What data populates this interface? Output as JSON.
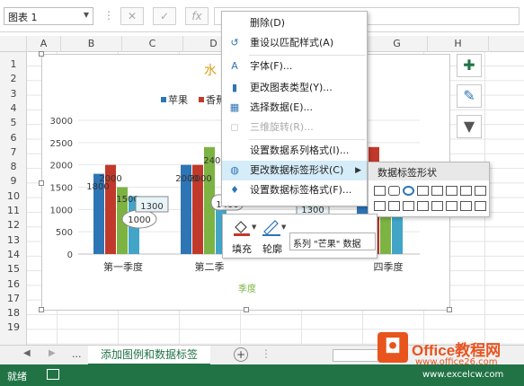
{
  "formula_bar": {
    "name_box": "图表 1",
    "cancel": "✕",
    "enter": "✓",
    "fx": "fx"
  },
  "columns": [
    "A",
    "B",
    "C",
    "D",
    "E",
    "F",
    "G",
    "H"
  ],
  "rows": [
    "1",
    "2",
    "3",
    "4",
    "5",
    "6",
    "7",
    "8",
    "9",
    "10",
    "11",
    "12",
    "13",
    "14",
    "15",
    "16",
    "17",
    "18",
    "19"
  ],
  "chart": {
    "title_fragment": "水",
    "legend": [
      {
        "name": "苹果",
        "color": "#2e75b6"
      },
      {
        "name": "香蕉",
        "color": "#c0392b"
      }
    ],
    "x_axis_title": "季度",
    "visible_value_labels": {
      "b1": "1800",
      "b2": "2000",
      "s1": "2000",
      "s2": "2000",
      "s3": "2400",
      "s4": "1500",
      "n1": "1000",
      "n2": "1300",
      "n3": "1400",
      "n4": "1300"
    },
    "series_colors": [
      "#2e75b6",
      "#c0392b",
      "#7cb342",
      "#42a5c8"
    ]
  },
  "chart_data": {
    "type": "bar",
    "title": "",
    "xlabel": "季度",
    "ylabel": "",
    "ylim": [
      0,
      3000
    ],
    "yticks": [
      "0",
      "500",
      "1000",
      "1500",
      "2000",
      "2500",
      "3000"
    ],
    "categories": [
      "第一季度",
      "第二季",
      "",
      "四季度"
    ],
    "series": [
      {
        "name": "苹果",
        "values": [
          1800,
          2000,
          null,
          1800
        ]
      },
      {
        "name": "香蕉",
        "values": [
          2000,
          2000,
          null,
          2400
        ]
      },
      {
        "name": "",
        "values": [
          1500,
          2400,
          null,
          1600
        ]
      },
      {
        "name": "",
        "values": [
          1300,
          1300,
          null,
          1300
        ]
      }
    ]
  },
  "side_buttons": [
    {
      "name": "chart-elements",
      "glyph": "✚"
    },
    {
      "name": "chart-styles",
      "glyph": "✎"
    },
    {
      "name": "chart-filters",
      "glyph": "▼"
    }
  ],
  "context_menu": {
    "items": [
      {
        "label": "删除(D)",
        "icon": "",
        "disabled": false
      },
      {
        "label": "重设以匹配样式(A)",
        "icon": "↺",
        "disabled": false
      },
      {
        "label": "字体(F)...",
        "icon": "A",
        "disabled": false
      },
      {
        "label": "更改图表类型(Y)...",
        "icon": "▮",
        "disabled": false
      },
      {
        "label": "选择数据(E)...",
        "icon": "▦",
        "disabled": false
      },
      {
        "label": "三维旋转(R)...",
        "icon": "◻",
        "disabled": true
      },
      {
        "label": "设置数据系列格式(I)...",
        "icon": "",
        "disabled": false
      },
      {
        "label": "更改数据标签形状(C)",
        "icon": "◍",
        "disabled": false,
        "submenu": true
      },
      {
        "label": "设置数据标签格式(F)...",
        "icon": "♦",
        "disabled": false
      }
    ]
  },
  "submenu": {
    "title": "数据标签形状"
  },
  "mini_toolbar": {
    "fill_label": "填充",
    "outline_label": "轮廓",
    "series_value": "系列 \"芒果\" 数据"
  },
  "sheet_tabs": {
    "active": "添加图例和数据标签",
    "ellipsis": "...",
    "add": "+"
  },
  "status": {
    "ready": "就绪"
  },
  "watermark": {
    "brand": "Office教程网",
    "url": "www.office26.com",
    "url2": "www.excelcw.com"
  }
}
